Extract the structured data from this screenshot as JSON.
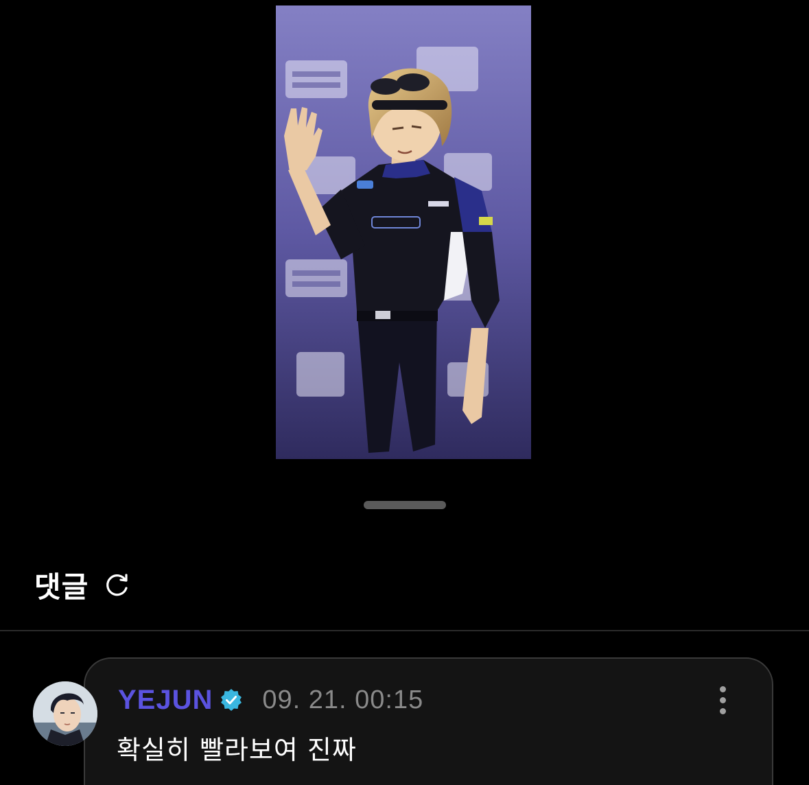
{
  "media": {
    "type": "character-image",
    "description_icon": "image-icon"
  },
  "comments": {
    "title": "댓글",
    "refresh_icon": "refresh-icon",
    "items": [
      {
        "author": "YEJUN",
        "verified": true,
        "timestamp": "09. 21. 00:15",
        "text": "확실히 빨라보여 진짜",
        "author_color": "#5b53e0"
      }
    ]
  },
  "colors": {
    "background": "#000000",
    "accent": "#5b53e0",
    "verified_badge": "#3ab7e0",
    "card_border": "#3a3a3a",
    "muted_text": "#8a8a8a"
  }
}
